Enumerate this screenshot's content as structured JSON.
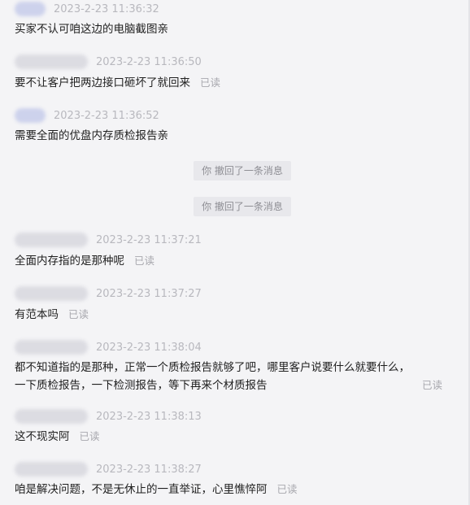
{
  "messages": [
    {
      "time": "2023-2-23 11:36:32",
      "text": "买家不认可咱这边的电脑截图亲",
      "read": ""
    },
    {
      "time": "2023-2-23 11:36:50",
      "text": "要不让客户把两边接口砸坏了就回来",
      "read": "已读"
    },
    {
      "time": "2023-2-23 11:36:52",
      "text": "需要全面的优盘内存质检报告亲",
      "read": ""
    },
    {
      "time": "2023-2-23 11:37:21",
      "text": "全面内存指的是那种呢",
      "read": "已读"
    },
    {
      "time": "2023-2-23 11:37:27",
      "text": "有范本吗",
      "read": "已读"
    },
    {
      "time": "2023-2-23 11:38:04",
      "text_line1": "都不知道指的是那种，正常一个质检报告就够了吧，哪里客户说要什么就要什么，",
      "text_line2": "一下质检报告，一下检测报告，等下再来个材质报告",
      "read": "已读"
    },
    {
      "time": "2023-2-23 11:38:13",
      "text": "这不现实阿",
      "read": "已读"
    },
    {
      "time": "2023-2-23 11:38:27",
      "text": "咱是解决问题，不是无休止的一直举证，心里憔悴阿",
      "read": "已读"
    }
  ],
  "recalls": [
    {
      "text": "你 撤回了一条消息"
    },
    {
      "text": "你 撤回了一条消息"
    }
  ]
}
